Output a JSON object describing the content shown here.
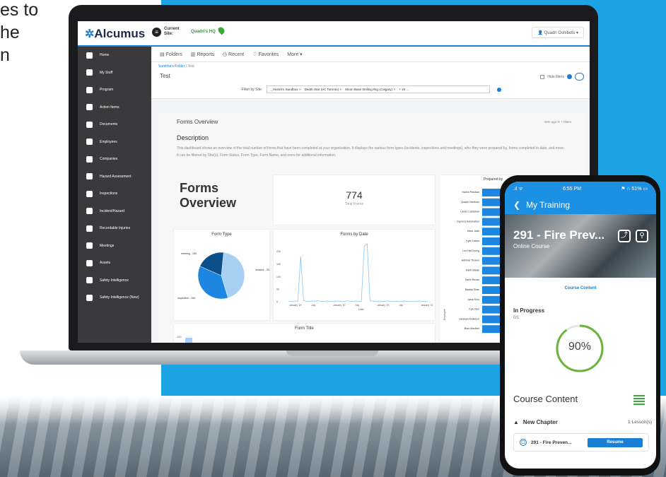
{
  "left_text": [
    "es to",
    "he",
    "n"
  ],
  "app": {
    "logo": "Alcumus",
    "current_site_label": [
      "Current",
      "Site:"
    ],
    "site_name": "Quadri's HQ",
    "user": "Quadri Oshibotu",
    "sidebar": [
      {
        "label": "Home",
        "icon": "home-icon"
      },
      {
        "label": "My Stuff",
        "icon": "briefcase-icon"
      },
      {
        "label": "Program",
        "icon": "list-icon"
      },
      {
        "label": "Action Items",
        "icon": "checkbox-icon"
      },
      {
        "label": "Documents",
        "icon": "document-icon"
      },
      {
        "label": "Employees",
        "icon": "person-icon"
      },
      {
        "label": "Companies",
        "icon": "building-icon"
      },
      {
        "label": "Hazard Assessment",
        "icon": "hazard-person-icon"
      },
      {
        "label": "Inspections",
        "icon": "checklist-icon"
      },
      {
        "label": "Incident/Hazard",
        "icon": "warning-icon"
      },
      {
        "label": "Recordable Injuries",
        "icon": "clipboard-icon"
      },
      {
        "label": "Meetings",
        "icon": "group-icon"
      },
      {
        "label": "Assets",
        "icon": "truck-icon"
      },
      {
        "label": "Safety Intelligence",
        "icon": "chart-icon"
      },
      {
        "label": "Safety Intelligence (New)",
        "icon": "pie-icon"
      }
    ],
    "tabs": [
      "Folders",
      "Reports",
      "Recent",
      "Favorites",
      "More"
    ],
    "breadcrumb": {
      "folder": "Sumitha's Folder",
      "sep": "/",
      "current": "Test"
    },
    "title": "Test",
    "hide_filters": "Hide filters",
    "filter_label": "Filter by Site:",
    "filter_chips": [
      "_Harish's Sandbox ×",
      "Death Star (eC Toronto) ×",
      "Moon Base Drilling Rig (Calgary) ×",
      "+ 10 ..."
    ],
    "panel": {
      "title": "Forms Overview",
      "meta": "35m ago   ⟳   7 filters",
      "desc_title": "Description",
      "desc_1": "This dashboard shows an overview of the total number of forms that have been completed at your organization. It displays the various form types (incidents, inspections and meetings), who they were prepared by, forms completed to date, and more.",
      "desc_2": "It can be filtered by Site(s), Form Status, Form Type, Form Name, and more for additional information.",
      "big_title": [
        "Forms",
        "Overview"
      ],
      "total": "774",
      "total_label": "Total Forms",
      "form_type_title": "Form Type",
      "form_date_title": "Forms by Date",
      "form_title_title": "Form Title",
      "prepared_title": "Prepared by",
      "prepared_by": [
        "Harish Pandian",
        "Quadri Oshibotu",
        "Lando Calrissian",
        "Cypress Automation",
        "Mara Jade",
        "Kyle Katarn",
        "Luu Hai Duong",
        "Admiral Thrawn",
        "Darth Malak",
        "Darth Revan",
        "Bastila Shan",
        "Jaina Solo",
        "Kylo Ren",
        "Saranya Mullaiyur",
        "Blair MacNeil"
      ],
      "form_title_y": "150"
    }
  },
  "chart_data": [
    {
      "type": "pie",
      "title": "Form Type",
      "categories": [
        "Incident",
        "Inspection",
        "Meeting"
      ],
      "values": [
        339,
        280,
        155
      ],
      "labels": [
        "incident - 339",
        "inspection - 280",
        "meeting - 155"
      ]
    },
    {
      "type": "line",
      "title": "Forms by Date",
      "xlabel": "Date",
      "x_ticks": [
        "January '19",
        "July",
        "January '20",
        "July",
        "January '21",
        "July",
        "January '22"
      ],
      "y_ticks": [
        "0",
        "50",
        "100",
        "150",
        "200"
      ],
      "ylim": [
        0,
        230
      ],
      "series": [
        {
          "values": [
            2,
            1,
            3,
            2,
            180,
            5,
            2,
            1,
            3,
            2,
            4,
            1,
            2,
            3,
            2,
            1,
            2,
            3,
            2,
            1,
            4,
            2,
            1,
            3,
            2,
            1,
            220,
            230,
            4,
            2,
            1,
            3,
            2,
            1,
            3,
            2,
            1,
            2,
            1,
            2,
            3,
            1,
            2,
            1,
            2,
            3,
            2,
            1,
            2
          ]
        }
      ]
    },
    {
      "type": "bar",
      "title": "Prepared by",
      "ylabel": "Employee",
      "categories": [
        "Harish Pandian",
        "Quadri Oshibotu",
        "Lando Calrissian",
        "Cypress Automation",
        "Mara Jade",
        "Kyle Katarn",
        "Luu Hai Duong",
        "Admiral Thrawn",
        "Darth Malak",
        "Darth Revan",
        "Bastila Shan",
        "Jaina Solo",
        "Kylo Ren",
        "Saranya Mullaiyur",
        "Blair MacNeil"
      ]
    }
  ],
  "phone": {
    "time": "6:55 PM",
    "battery": "51%",
    "title": "My Training",
    "course_title": "291 - Fire Prev...",
    "course_type": "Online Course",
    "course_content_link": "Course Content",
    "status": "In Progress",
    "status_count": "0/1",
    "progress": 0.9,
    "progress_label": "90%",
    "section_title": "Course Content",
    "chapter": "New Chapter",
    "lesson_count": "1 Lesson(s)",
    "lesson_name": "291 - Fire Preven...",
    "resume": "Resume"
  },
  "colors": {
    "accent": "#1c7fd6",
    "background": "#1ca3e3",
    "sidebar": "#3a3a3c",
    "progress": "#6ab43c",
    "pie_dark": "#0d4f8b",
    "pie_mid": "#1c86e0",
    "pie_light": "#a8d0f5"
  }
}
